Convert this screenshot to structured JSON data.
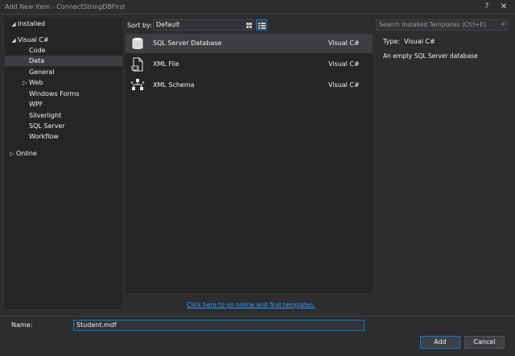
{
  "window": {
    "title": "Add New Item - ConnectStringDBFirst",
    "help_label": "?",
    "close_label": "✕"
  },
  "sidebar": {
    "installed_label": "Installed",
    "root_label": "Visual C#",
    "children": [
      "Code",
      "Data",
      "General",
      "Web",
      "Windows Forms",
      "WPF",
      "Silverlight",
      "SQL Server",
      "Workflow"
    ],
    "online_label": "Online",
    "selected": "Data"
  },
  "toolbar": {
    "sort_label": "Sort by:",
    "sort_value": "Default"
  },
  "search": {
    "placeholder": "Search Installed Templates (Ctrl+E)"
  },
  "templates": [
    {
      "name": "SQL Server Database",
      "language": "Visual C#",
      "icon": "database-icon",
      "selected": true
    },
    {
      "name": "XML File",
      "language": "Visual C#",
      "icon": "xml-file-icon",
      "selected": false
    },
    {
      "name": "XML Schema",
      "language": "Visual C#",
      "icon": "xml-schema-icon",
      "selected": false
    }
  ],
  "details": {
    "type_label": "Type:",
    "type_value": "Visual C#",
    "description": "An empty SQL Server database"
  },
  "online_link": "Click here to go online and find templates.",
  "name_field": {
    "label": "Name:",
    "value": "Student.mdf"
  },
  "buttons": {
    "add": "Add",
    "cancel": "Cancel"
  },
  "colors": {
    "background": "#2d2d30",
    "panel": "#252526",
    "selection": "#3e3e42",
    "accent": "#007acc",
    "link": "#3399ff"
  }
}
